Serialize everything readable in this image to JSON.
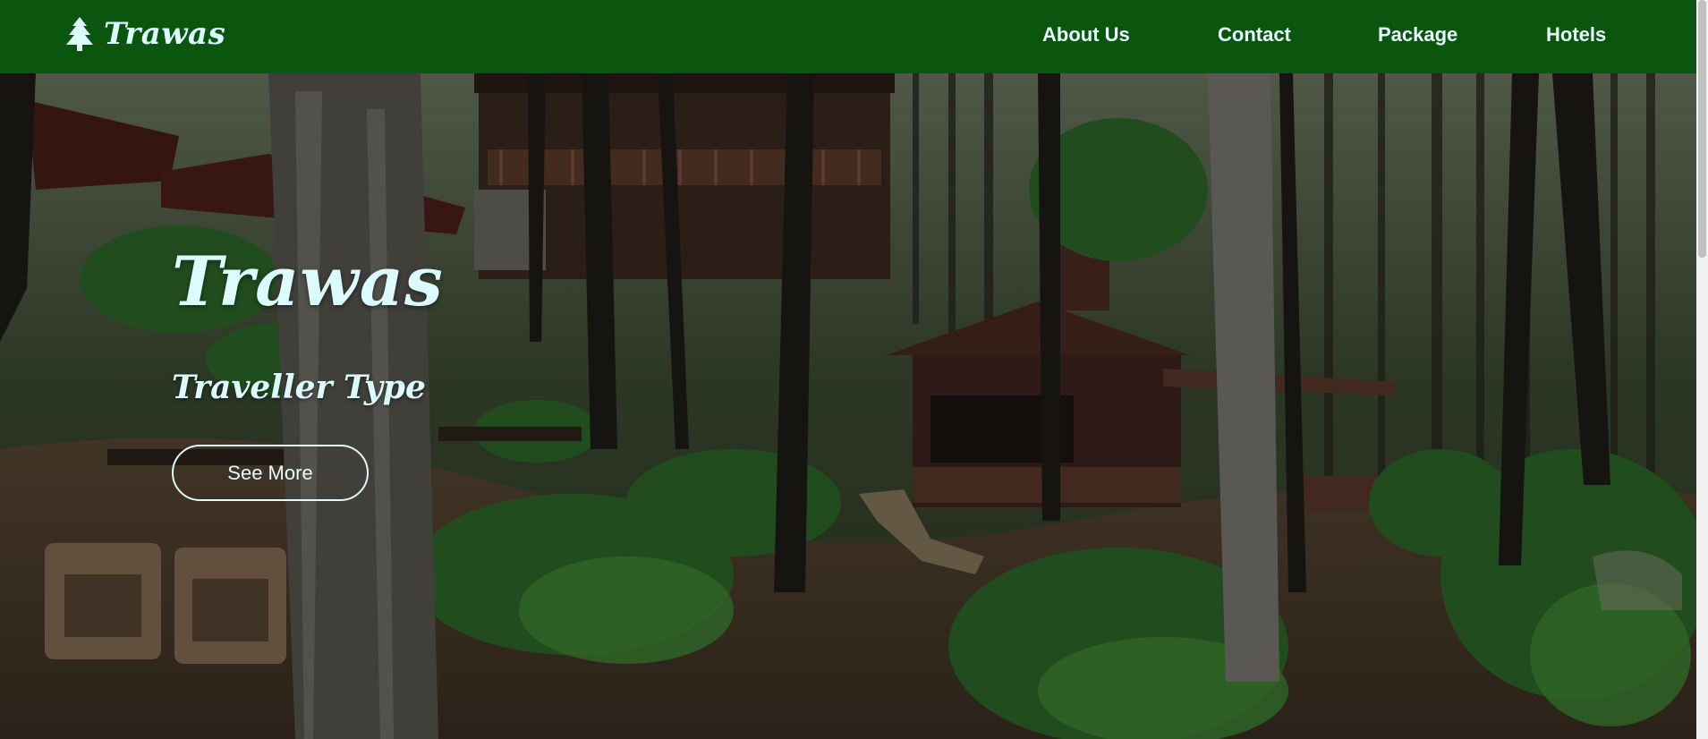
{
  "navbar": {
    "brand_name": "Trawas",
    "brand_icon": "pine-tree-icon",
    "background_color": "#0b560f",
    "links": [
      {
        "label": "About Us"
      },
      {
        "label": "Contact"
      },
      {
        "label": "Package"
      },
      {
        "label": "Hotels"
      }
    ]
  },
  "hero": {
    "background_image": "forest-cabins-photo",
    "title": "Trawas",
    "subtitle": "Traveller Type",
    "button_label": "See More",
    "text_color": "#dcfbff"
  }
}
